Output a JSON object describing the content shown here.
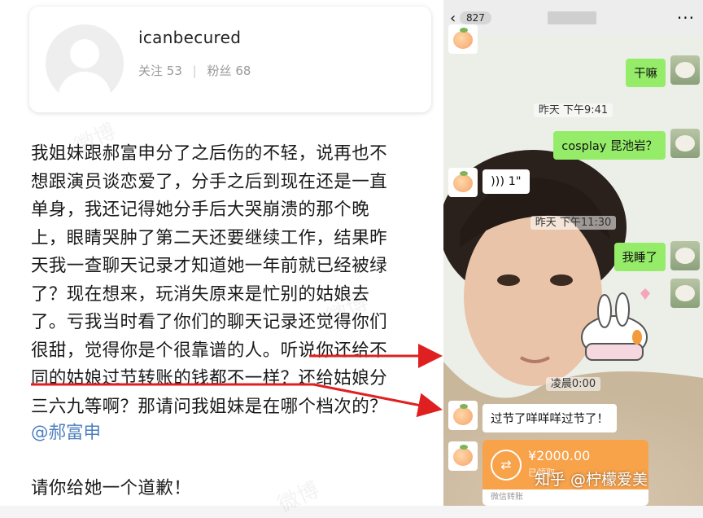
{
  "left": {
    "profile": {
      "username": "icanbecured",
      "following_label": "关注",
      "following_count": "53",
      "followers_label": "粉丝",
      "followers_count": "68"
    },
    "post_lines": [
      "我姐妹跟郝富申分了之后伤的不轻，说再也不",
      "想跟演员谈恋爱了，分手之后到现在还是一直",
      "单身，我还记得她分手后大哭崩溃的那个晚",
      "上，眼睛哭肿了第二天还要继续工作，结果昨",
      "天我一查聊天记录才知道她一年前就已经被绿",
      "了？现在想来，玩消失原来是忙别的姑娘去",
      "了。亏我当时看了你们的聊天记录还觉得你们",
      "很甜，觉得你是个很靠谱的人。听说你还给不",
      "同的姑娘过节转账的钱都不一样？还给姑娘分",
      "三六九等啊？那请问我姐妹是在哪个档次的？"
    ],
    "mention": "@郝富申",
    "closing": "请你给她一个道歉！",
    "watermark": "微博"
  },
  "right": {
    "topbar": {
      "back": "‹",
      "unread": "827",
      "more": "···"
    },
    "messages": {
      "m1": "干嘛",
      "t1": "昨天 下午9:41",
      "m2": "cosplay 昆池岩？",
      "voice": "1\"",
      "t2": "昨天 下午11:30",
      "m3": "我睡了",
      "t3": "凌晨0:00",
      "m4": "过节了咩咩咩过节了！"
    },
    "transfer": {
      "amount": "¥2000.00",
      "status": "已领取",
      "footer": "微信转账"
    },
    "watermark": "知乎 @柠檬爱美"
  },
  "colors": {
    "arrow": "#e02020",
    "wechat_green": "#95ec69",
    "transfer_orange": "#f8a24a",
    "mention_blue": "#4d7fbe"
  }
}
